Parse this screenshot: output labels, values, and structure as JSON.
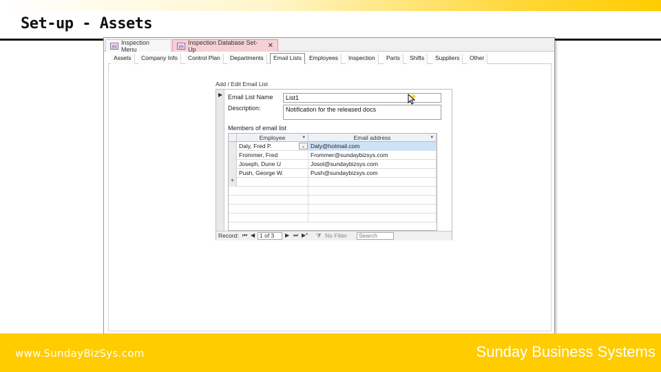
{
  "slide": {
    "title": "Set-up - Assets",
    "footer_url": "www.SundayBizSys.com",
    "footer_company": "Sunday Business Systems"
  },
  "doc_tabs": [
    {
      "label": "Inspection Menu"
    },
    {
      "label": "Inspection Database Set-Up"
    }
  ],
  "sub_tabs": [
    {
      "label": "Assets"
    },
    {
      "label": "Company Info"
    },
    {
      "label": "Control Plan"
    },
    {
      "label": "Departments"
    },
    {
      "label": "Email Lists"
    },
    {
      "label": "Employees"
    },
    {
      "label": "Inspection"
    },
    {
      "label": "Parts"
    },
    {
      "label": "Shifts"
    },
    {
      "label": "Suppliers"
    },
    {
      "label": "Other"
    }
  ],
  "active_sub_tab": "Email Lists",
  "subform": {
    "caption": "Add / Edit Email List",
    "list_name_label": "Email List Name",
    "list_name_value": "List1",
    "description_label": "Description:",
    "description_value": "Notification for the released docs",
    "members_label": "Members of email list",
    "columns": [
      "Employee",
      "Email address"
    ],
    "rows": [
      {
        "employee": "Daly, Fred P.",
        "email": "Daly@hotmail.com",
        "selected": true
      },
      {
        "employee": "Frommer, Fred",
        "email": "Frommer@sundaybizsys.com"
      },
      {
        "employee": "Joseph, Dune U",
        "email": "Josol@sundaybizsys.com"
      },
      {
        "employee": "Push, George W.",
        "email": "Push@sundaybizsys.com"
      }
    ],
    "new_row_marker": "*"
  },
  "record_nav": {
    "label": "Record:",
    "position": "1 of 3",
    "filter": "No Filter",
    "search": "Search"
  },
  "colors": {
    "accent_yellow": "#ffcc00",
    "tab_active_pink": "#f6d0d4",
    "row_highlight": "#cfe3f7"
  }
}
